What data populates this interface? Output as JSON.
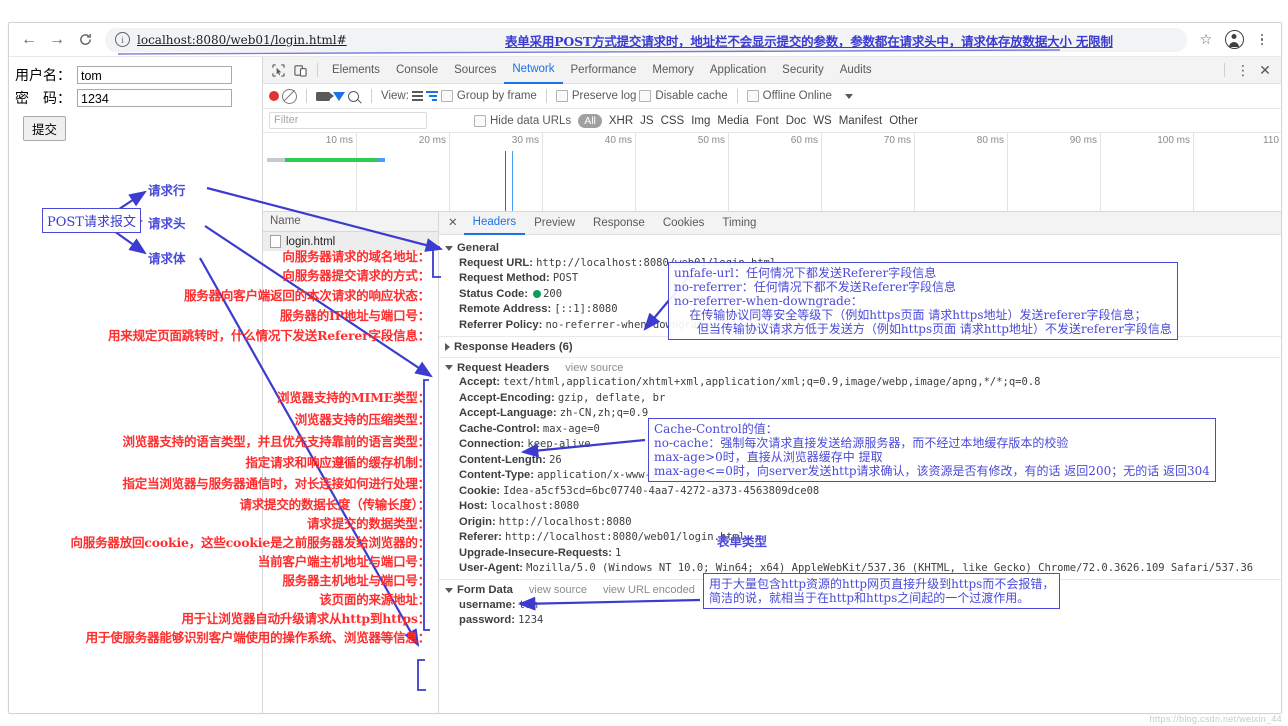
{
  "browser": {
    "back_icon": "←",
    "forward_icon": "→",
    "reload_icon": "C",
    "info_icon": "i",
    "url": "localhost:8080/web01/login.html#",
    "url_note": "表单采用POST方式提交请求时，地址栏不会显示提交的参数，参数都在请求头中，请求体存放数据大小 无限制",
    "star_icon": "☆",
    "profile_icon": "profile-avatar",
    "menu_icon": "⋮"
  },
  "page": {
    "username_label": "用户名：",
    "username_value": "tom",
    "password_label": "密　码：",
    "password_value": "1234",
    "submit_label": "提交"
  },
  "devtools": {
    "tabs": [
      "Elements",
      "Console",
      "Sources",
      "Network",
      "Performance",
      "Memory",
      "Application",
      "Security",
      "Audits"
    ],
    "active_tab": "Network",
    "close_label": "✕",
    "more_label": "⋮",
    "toolbar": {
      "view_label": "View:",
      "group_by_frame": "Group by frame",
      "preserve_log": "Preserve log",
      "disable_cache": "Disable cache",
      "offline": "Offline",
      "throttling": "Online"
    },
    "filterbar": {
      "filter_placeholder": "Filter",
      "hide_data_urls": "Hide data URLs",
      "types": [
        "All",
        "XHR",
        "JS",
        "CSS",
        "Img",
        "Media",
        "Font",
        "Doc",
        "WS",
        "Manifest",
        "Other"
      ],
      "active_type": "All"
    },
    "overview": {
      "ticks": [
        "10 ms",
        "20 ms",
        "30 ms",
        "40 ms",
        "50 ms",
        "60 ms",
        "70 ms",
        "80 ms",
        "90 ms",
        "100 ms",
        "110"
      ]
    },
    "requests": {
      "column_header": "Name",
      "rows": [
        {
          "name": "login.html"
        }
      ]
    },
    "detail_tabs": [
      "Headers",
      "Preview",
      "Response",
      "Cookies",
      "Timing"
    ],
    "detail_active_tab": "Headers",
    "general": {
      "title": "General",
      "items": [
        {
          "key": "Request URL:",
          "value": "http://localhost:8080/web01/login.html"
        },
        {
          "key": "Request Method:",
          "value": "POST"
        },
        {
          "key": "Status Code:",
          "value": "200"
        },
        {
          "key": "Remote Address:",
          "value": "[::1]:8080"
        },
        {
          "key": "Referrer Policy:",
          "value": "no-referrer-when-downgrade"
        }
      ]
    },
    "response_headers": {
      "title": "Response Headers (6)"
    },
    "request_headers": {
      "title": "Request Headers",
      "view_source": "view source",
      "items": [
        {
          "key": "Accept:",
          "value": "text/html,application/xhtml+xml,application/xml;q=0.9,image/webp,image/apng,*/*;q=0.8"
        },
        {
          "key": "Accept-Encoding:",
          "value": "gzip, deflate, br"
        },
        {
          "key": "Accept-Language:",
          "value": "zh-CN,zh;q=0.9"
        },
        {
          "key": "Cache-Control:",
          "value": "max-age=0"
        },
        {
          "key": "Connection:",
          "value": "keep-alive"
        },
        {
          "key": "Content-Length:",
          "value": "26"
        },
        {
          "key": "Content-Type:",
          "value": "application/x-www-form-urlencoded"
        },
        {
          "key": "Cookie:",
          "value": "Idea-a5cf53cd=6bc07740-4aa7-4272-a373-4563809dce08"
        },
        {
          "key": "Host:",
          "value": "localhost:8080"
        },
        {
          "key": "Origin:",
          "value": "http://localhost:8080"
        },
        {
          "key": "Referer:",
          "value": "http://localhost:8080/web01/login.html"
        },
        {
          "key": "Upgrade-Insecure-Requests:",
          "value": "1"
        },
        {
          "key": "User-Agent:",
          "value": "Mozilla/5.0 (Windows NT 10.0; Win64; x64) AppleWebKit/537.36 (KHTML, like Gecko) Chrome/72.0.3626.109 Safari/537.36"
        }
      ]
    },
    "form_data": {
      "title": "Form Data",
      "view_source": "view source",
      "view_url_encoded": "view URL encoded",
      "items": [
        {
          "key": "username:",
          "value": "tom"
        },
        {
          "key": "password:",
          "value": "1234"
        }
      ]
    }
  },
  "annotations": {
    "main_label": "POST请求报文",
    "branches": [
      "请求行",
      "请求头",
      "请求体"
    ],
    "general_notes": [
      "向服务器请求的域名地址：",
      "向服务器提交请求的方式：",
      "服务器向客户端返回的本次请求的响应状态：",
      "服务器的IP地址与端口号：",
      "用来规定页面跳转时，什么情况下发送Referer字段信息："
    ],
    "header_notes": [
      "浏览器支持的MIME类型：",
      "浏览器支持的压缩类型：",
      "浏览器支持的语言类型，并且优先支持靠前的语言类型：",
      "指定请求和响应遵循的缓存机制：",
      "指定当浏览器与服务器通信时，对长连接如何进行处理：",
      "请求提交的数据长度（传输长度）：",
      "请求提交的数据类型：",
      "向服务器放回cookie，这些cookie是之前服务器发给浏览器的：",
      "当前客户端主机地址与端口号：",
      "服务器主机地址与端口号：",
      "该页面的来源地址：",
      "用于让浏览器自动升级请求从http到https：",
      "用于使服务器能够识别客户端使用的操作系统、浏览器等信息："
    ],
    "referrer_policy_box": "unfafe-url：任何情况下都发送Referer字段信息\nno-referrer：任何情况下都不发送Referer字段信息\nno-referrer-when-downgrade：\n    在传输协议同等安全等级下（例如https页面 请求https地址）发送referer字段信息；\n      但当传输协议请求方低于发送方（例如https页面 请求http地址）不发送referer字段信息",
    "cache_control_box": "Cache-Control的值：\nno-cache：强制每次请求直接发送给源服务器，而不经过本地缓存版本的校验\nmax-age>0时，直接从浏览器缓存中 提取\nmax-age<=0时，向server发送http请求确认，该资源是否有修改，有的话 返回200；无的话 返回304",
    "upgrade_box": "用于大量包含http资源的http网页直接升级到https而不会报错，\n简洁的说，就相当于在http和https之间起的一个过渡作用。",
    "content_type_note": "表单类型",
    "watermark": "https://blog.csdn.net/weixin_44"
  }
}
